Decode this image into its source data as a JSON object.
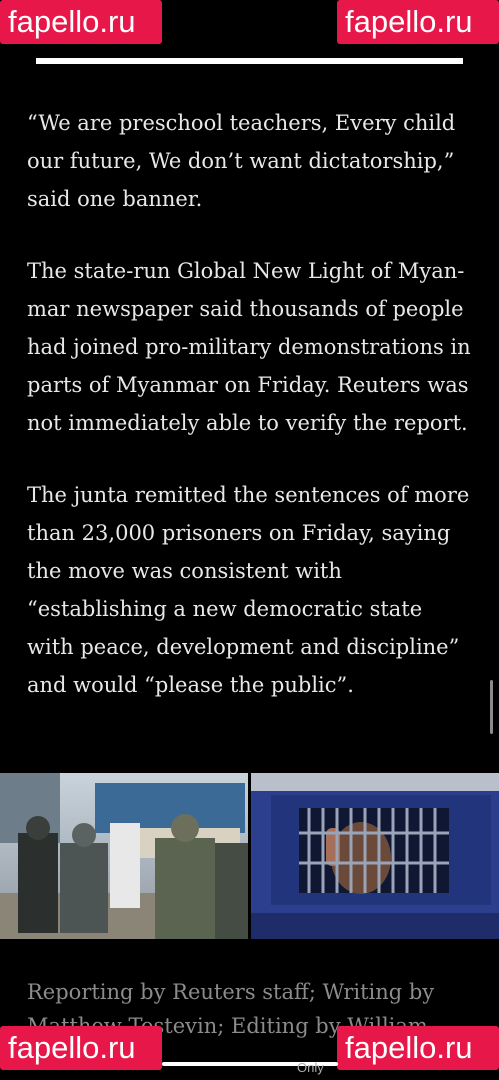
{
  "watermarks": {
    "text": "fapello.ru",
    "color": "#e8174a"
  },
  "progress": {
    "fraction": 1.0
  },
  "article": {
    "paragraphs": [
      "“We are preschool teachers, Every child our future, We don’t want dictatorship,” said one banner.",
      "The state-run Global New Light of Myan­mar newspaper said thousands of people had joined pro-military demonstrations in parts of Myanmar on Friday. Reuters was not immediately able to verify the report.",
      "The junta remitted the sentences of more than 23,000 prisoners on Friday, saying the move was consistent with “establishing a new democratic state with peace, devel­opment and discipline” and would “please the public”."
    ]
  },
  "caption": {
    "text": "Reporting by Reuters staff; Writing by Matthew Tostevin; Editing by William Mal-"
  },
  "footer": {
    "only_text": "Only"
  }
}
